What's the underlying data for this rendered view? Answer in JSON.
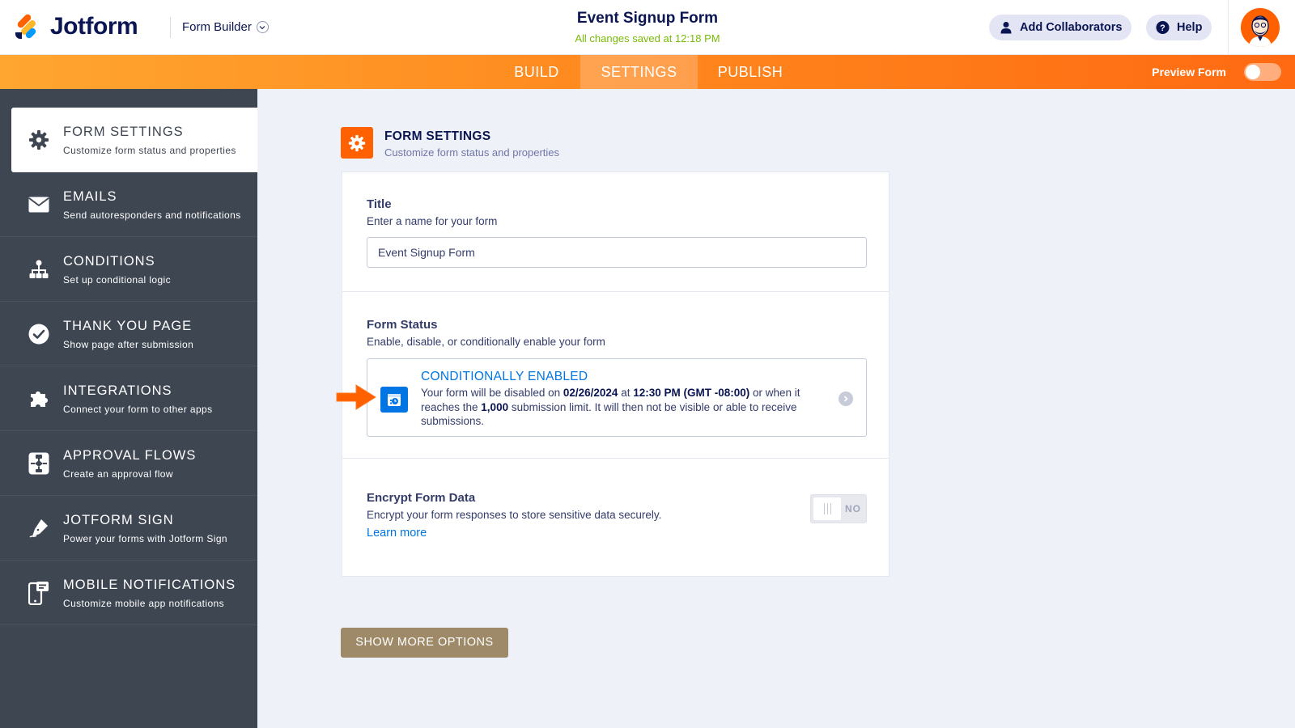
{
  "header": {
    "brand": "Jotform",
    "builder_label": "Form Builder",
    "form_title": "Event Signup Form",
    "saved_status": "All changes saved at 12:18 PM",
    "add_collaborators": "Add Collaborators",
    "help": "Help"
  },
  "tabs": [
    {
      "label": "BUILD",
      "active": false
    },
    {
      "label": "SETTINGS",
      "active": true
    },
    {
      "label": "PUBLISH",
      "active": false
    }
  ],
  "preview": {
    "label": "Preview Form",
    "on": false
  },
  "sidebar": {
    "items": [
      {
        "title": "FORM SETTINGS",
        "subtitle": "Customize form status and properties",
        "icon": "gear-icon",
        "active": true
      },
      {
        "title": "EMAILS",
        "subtitle": "Send autoresponders and notifications",
        "icon": "envelope-icon"
      },
      {
        "title": "CONDITIONS",
        "subtitle": "Set up conditional logic",
        "icon": "hierarchy-icon"
      },
      {
        "title": "THANK YOU PAGE",
        "subtitle": "Show page after submission",
        "icon": "check-circle-icon"
      },
      {
        "title": "INTEGRATIONS",
        "subtitle": "Connect your form to other apps",
        "icon": "puzzle-icon"
      },
      {
        "title": "APPROVAL FLOWS",
        "subtitle": "Create an approval flow",
        "icon": "approval-flow-icon"
      },
      {
        "title": "JOTFORM SIGN",
        "subtitle": "Power your forms with Jotform Sign",
        "icon": "pen-nib-icon"
      },
      {
        "title": "MOBILE NOTIFICATIONS",
        "subtitle": "Customize mobile app notifications",
        "icon": "mobile-notification-icon"
      }
    ]
  },
  "main": {
    "section_title": "FORM SETTINGS",
    "section_subtitle": "Customize form status and properties",
    "title_field": {
      "label": "Title",
      "help": "Enter a name for your form",
      "value": "Event Signup Form"
    },
    "form_status": {
      "label": "Form Status",
      "help": "Enable, disable, or conditionally enable your form",
      "status": "CONDITIONALLY ENABLED",
      "desc_1": "Your form will be disabled on ",
      "date": "02/26/2024",
      "desc_2": " at ",
      "time": "12:30 PM (GMT -08:00)",
      "desc_3": " or when it reaches the ",
      "limit": "1,000",
      "desc_4": " submission limit. It will then not be visible or able to receive submissions."
    },
    "encrypt": {
      "label": "Encrypt Form Data",
      "help": "Encrypt your form responses to store sensitive data securely.",
      "learn_more": "Learn more",
      "toggle_value": "NO"
    },
    "show_more": "SHOW MORE OPTIONS"
  },
  "colors": {
    "accent_orange": "#ff6100",
    "link_blue": "#0075e3",
    "sidebar_bg": "#3e4652",
    "saved_green": "#78bb07",
    "more_button": "#9e8a68"
  }
}
